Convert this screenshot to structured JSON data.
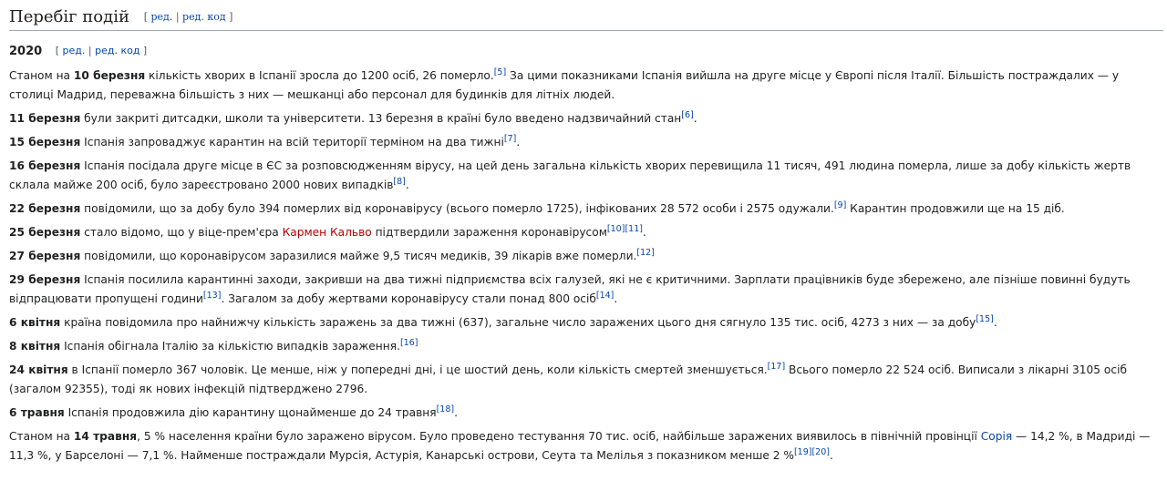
{
  "section": {
    "title": "Перебіг подій"
  },
  "edit": {
    "open": "[",
    "edit": "ред.",
    "sep": "|",
    "edit_code": "ред. код",
    "close": "]"
  },
  "sub": {
    "title": "2020"
  },
  "p": [
    {
      "date": "10 березня",
      "pre": "Станом на ",
      "text": " кількість хворих в Іспанії зросла до 1200 осіб, 26 померло.",
      "ref": "[5]",
      "text2": " За цими показниками Іспанія вийшла на друге місце у Європі після Італії. Більшість постраждалих — у столиці Мадрид, переважна більшість з них — мешканці або персонал для будинків для літніх людей."
    },
    {
      "date": "11 березня",
      "text": " були закриті дитсадки, школи та університети. 13 березня в країні було введено надзвичайний стан",
      "ref": "[6]",
      "text2": "."
    },
    {
      "date": "15 березня",
      "text": " Іспанія запроваджує карантин на всій території терміном на два тижні",
      "ref": "[7]",
      "text2": "."
    },
    {
      "date": "16 березня",
      "text": " Іспанія посідала друге місце в ЄС за розповсюдженням вірусу, на цей день загальна кількість хворих перевищила 11 тисяч, 491 людина померла, лише за добу кількість жертв склала майже 200 осіб, було зареєстровано 2000 нових випадків",
      "ref": "[8]",
      "text2": "."
    },
    {
      "date": "22 березня",
      "text": " повідомили, що за добу було 394 померлих від коронавірусу (всього померло 1725), інфікованих 28 572 особи і 2575 одужали.",
      "ref": "[9]",
      "text2": " Карантин продовжили ще на 15 діб."
    },
    {
      "date": "25 березня",
      "text": " стало відомо, що у віце-прем'єра ",
      "link": "Кармен Кальво",
      "text_after": " підтвердили зараження коронавірусом",
      "ref": "[10]",
      "ref2": "[11]",
      "text2": "."
    },
    {
      "date": "27 березня",
      "text": " повідомили, що коронавірусом заразилися майже 9,5 тисяч медиків, 39 лікарів вже померли.",
      "ref": "[12]",
      "text2": ""
    },
    {
      "date": "29 березня",
      "text": " Іспанія посилила карантинні заходи, закривши на два тижні підприємства всіх галузей, які не є критичними. Зарплати працівників буде збережено, але пізніше повинні будуть відпрацювати пропущені години",
      "ref": "[13]",
      "text2": ". Загалом за добу жертвами коронавірусу стали понад 800 осіб",
      "ref2": "[14]",
      "text3": "."
    },
    {
      "date": "6 квітня",
      "text": " країна повідомила про найнижчу кількість заражень за два тижні (637), загальне число заражених цього дня сягнуло 135 тис. осіб, 4273 з них — за добу",
      "ref": "[15]",
      "text2": "."
    },
    {
      "date": "8 квітня",
      "text": " Іспанія обігнала Італію за кількістю випадків зараження.",
      "ref": "[16]",
      "text2": ""
    },
    {
      "date": "24 квітня",
      "text": " в Іспанії померло 367 чоловік. Це менше, ніж у попередні дні, і це шостий день, коли кількість смертей зменшується.",
      "ref": "[17]",
      "text2": " Всього померло 22 524 осіб. Виписали з лікарні 3105 осіб (загалом 92355), тоді як нових інфекцій підтверджено 2796."
    },
    {
      "date": "6 травня",
      "text": " Іспанія продовжила дію карантину щонайменше до 24 травня",
      "ref": "[18]",
      "text2": "."
    },
    {
      "pre": "Станом на ",
      "date": "14 травня",
      "text": ", 5 % населення країни було заражено вірусом. Було проведено тестування 70 тис. осіб, найбільше заражених виявилось в північній провінції ",
      "link": "Сорія",
      "text_after": " — 14,2 %, в Мадриді — 11,3 %, у Барселоні — 7,1 %. Найменше постраждали Мурсія, Астурія, Канарські острови, Сеута та Мелілья з показником менше 2 %",
      "ref": "[19]",
      "ref2": "[20]",
      "text2": "."
    }
  ]
}
